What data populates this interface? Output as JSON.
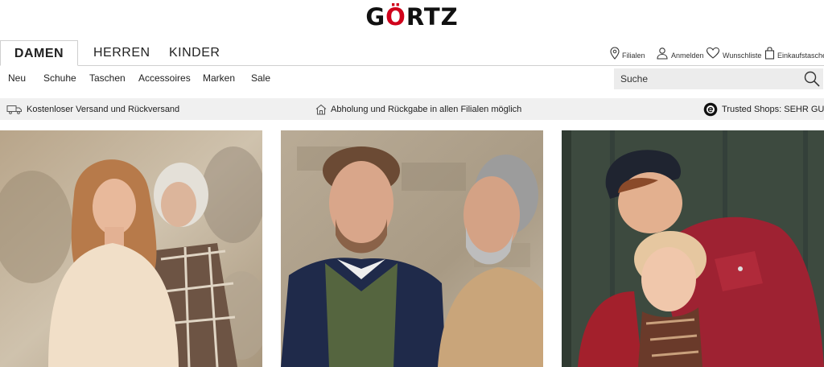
{
  "header": {
    "logo_text": "GÖRTZ"
  },
  "main_tabs": [
    "DAMEN",
    "HERREN",
    "KINDER"
  ],
  "utility_nav": [
    "Filialen",
    "Anmelden",
    "Wunschliste",
    "Einkaufstasche"
  ],
  "sub_nav": [
    "Neu",
    "Schuhe",
    "Taschen",
    "Accessoires",
    "Marken",
    "Sale"
  ],
  "search": {
    "placeholder": "Suche"
  },
  "info_bar": [
    {
      "icon": "truck-icon",
      "text": "Kostenloser Versand und Rückversand"
    },
    {
      "icon": "store-icon",
      "text": "Abholung und Rückgabe in allen Filialen möglich"
    },
    {
      "icon": "trusted-shops-icon",
      "text": "Trusted Shops: SEHR GUT"
    }
  ],
  "hero_tiles": [
    "women-campaign-image",
    "men-campaign-image",
    "kids-campaign-image"
  ],
  "colors": {
    "accent": "#d0021b",
    "bar": "#f0f0f0",
    "search_bg": "#ececec"
  }
}
